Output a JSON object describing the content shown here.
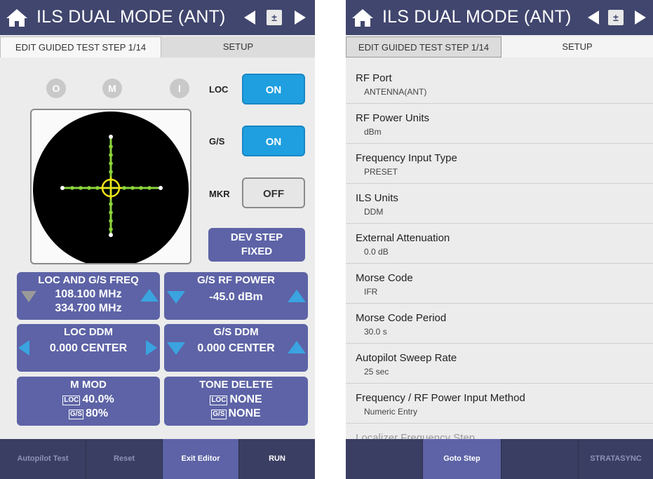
{
  "left": {
    "title": "ILS DUAL MODE (ANT)",
    "pm_label": "±",
    "tabs": [
      "EDIT GUIDED TEST STEP 1/14",
      "SETUP"
    ],
    "indicators": [
      "O",
      "M",
      "I"
    ],
    "switches": [
      {
        "label": "LOC",
        "state": "ON"
      },
      {
        "label": "G/S",
        "state": "ON"
      },
      {
        "label": "MKR",
        "state": "OFF"
      }
    ],
    "dev_step": {
      "line1": "DEV STEP",
      "line2": "FIXED"
    },
    "freq": {
      "title": "LOC AND G/S FREQ",
      "loc": "108.100 MHz",
      "gs": "334.700 MHz"
    },
    "rf_power": {
      "title": "G/S RF POWER",
      "value": "-45.0 dBm"
    },
    "loc_ddm": {
      "title": "LOC DDM",
      "value": "0.000 CENTER"
    },
    "gs_ddm": {
      "title": "G/S DDM",
      "value": "0.000 CENTER"
    },
    "m_mod": {
      "title": "M MOD",
      "loc_tag": "LOC",
      "loc_val": "40.0%",
      "gs_tag": "G/S",
      "gs_val": "80%"
    },
    "tone_delete": {
      "title": "TONE DELETE",
      "loc_tag": "LOC",
      "loc_val": "NONE",
      "gs_tag": "G/S",
      "gs_val": "NONE"
    },
    "bottom": [
      "Autopilot Test",
      "Reset",
      "Exit Editor",
      "RUN"
    ]
  },
  "right": {
    "title": "ILS DUAL MODE (ANT)",
    "pm_label": "±",
    "tabs": [
      "EDIT GUIDED TEST STEP 1/14",
      "SETUP"
    ],
    "settings": [
      {
        "label": "RF Port",
        "value": "ANTENNA(ANT)"
      },
      {
        "label": "RF Power Units",
        "value": "dBm"
      },
      {
        "label": "Frequency Input Type",
        "value": "PRESET"
      },
      {
        "label": "ILS Units",
        "value": "DDM"
      },
      {
        "label": "External Attenuation",
        "value": "0.0 dB"
      },
      {
        "label": "Morse Code",
        "value": "IFR"
      },
      {
        "label": "Morse Code Period",
        "value": "30.0 s"
      },
      {
        "label": "Autopilot Sweep Rate",
        "value": "25 sec"
      },
      {
        "label": "Frequency / RF Power Input Method",
        "value": "Numeric Entry"
      },
      {
        "label": "Localizer Frequency Step",
        "value": ""
      }
    ],
    "bottom": [
      "",
      "Goto Step",
      "",
      "STRATASYNC"
    ]
  },
  "colors": {
    "title_bar": "#41466e",
    "button": "#5d63a6",
    "switch_on": "#1f9fe0",
    "arrow": "#3aa3e0",
    "bottom_bar": "#3a3e62"
  }
}
